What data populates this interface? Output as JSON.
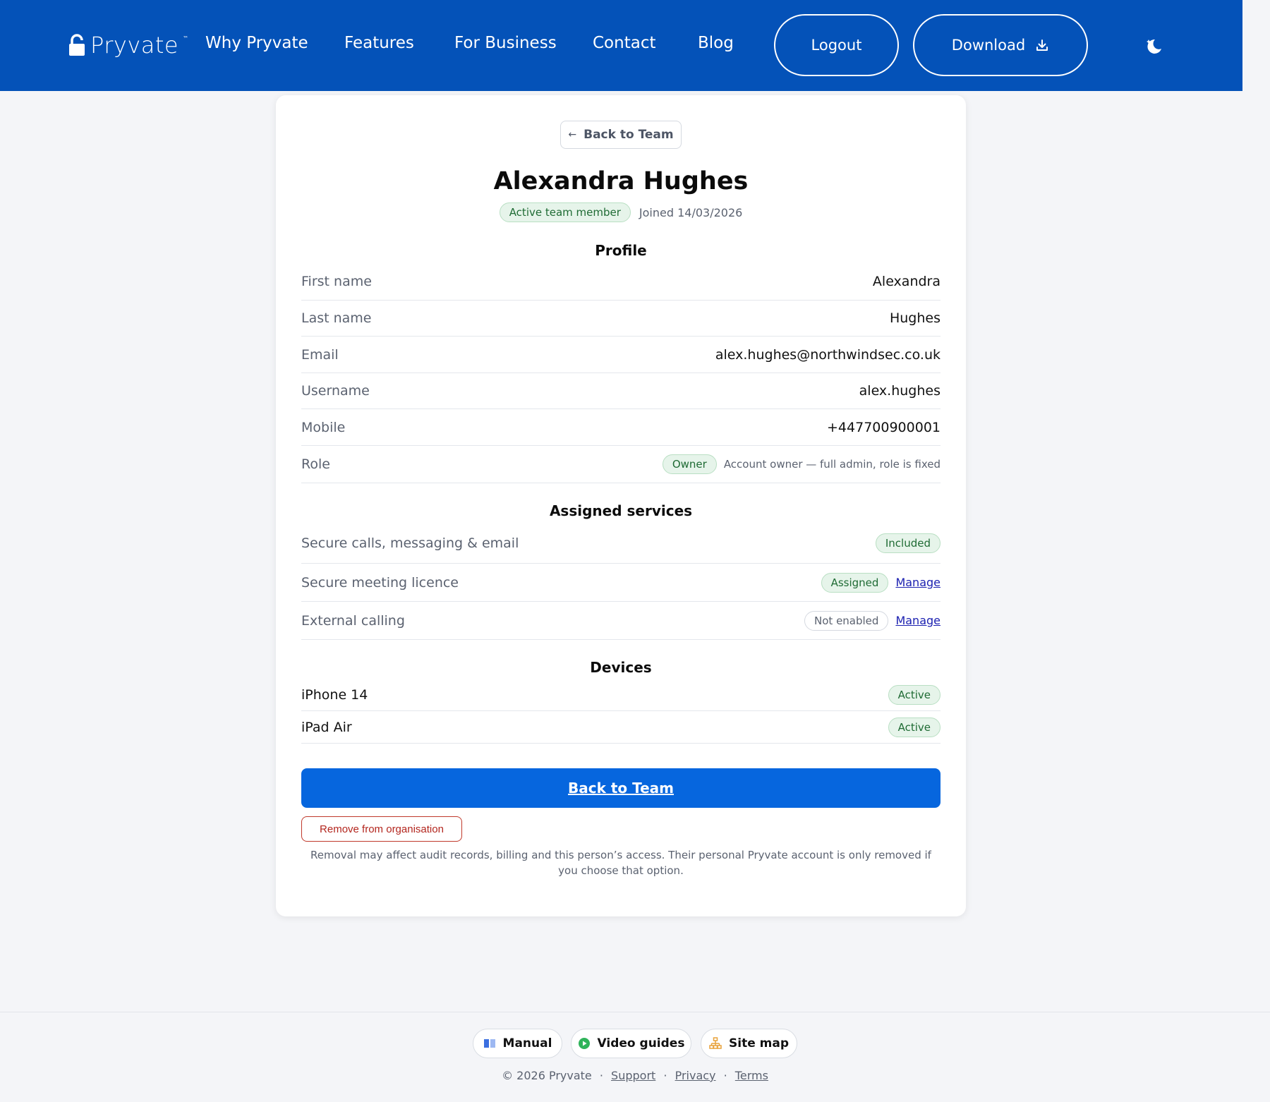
{
  "header": {
    "brand": "Pryvate",
    "brand_tm": "™",
    "nav": [
      "Why Pryvate",
      "Features",
      "For Business",
      "Contact",
      "Blog"
    ],
    "logout_label": "Logout",
    "download_label": "Download",
    "brand_color": "#0452b8"
  },
  "back_top_label": "Back to Team",
  "member": {
    "name": "Alexandra Hughes",
    "status_badge": "Active team member",
    "joined": "Joined 14/03/2026"
  },
  "profile": {
    "title": "Profile",
    "rows": [
      {
        "label": "First name",
        "value": "Alexandra"
      },
      {
        "label": "Last name",
        "value": "Hughes"
      },
      {
        "label": "Email",
        "value": "alex.hughes@northwindsec.co.uk"
      },
      {
        "label": "Username",
        "value": "alex.hughes"
      },
      {
        "label": "Mobile",
        "value": "+447700900001"
      }
    ],
    "role": {
      "label": "Role",
      "badge": "Owner",
      "note": "Account owner — full admin, role is fixed"
    }
  },
  "services": {
    "title": "Assigned services",
    "rows": [
      {
        "label": "Secure calls, messaging & email",
        "status": "Included",
        "manage": ""
      },
      {
        "label": "Secure meeting licence",
        "status": "Assigned",
        "manage": "Manage"
      },
      {
        "label": "External calling",
        "status": "Not enabled",
        "manage": "Manage"
      }
    ]
  },
  "devices": {
    "title": "Devices",
    "rows": [
      {
        "name": "iPhone 14",
        "status": "Active"
      },
      {
        "name": "iPad Air",
        "status": "Active"
      }
    ]
  },
  "actions": {
    "back_label": "Back to Team",
    "remove_label": "Remove from organisation",
    "removal_note": "Removal may affect audit records, billing and this person’s access. Their personal Pryvate account is only removed if you choose that option."
  },
  "footer": {
    "manual": "Manual",
    "video_guides": "Video guides",
    "site_map": "Site map",
    "copyright": "© 2026 Pryvate",
    "links": [
      "Support",
      "Privacy",
      "Terms"
    ]
  },
  "colors": {
    "primary_button": "#0666de",
    "success": "#1f6b34",
    "danger": "#b3261e"
  }
}
